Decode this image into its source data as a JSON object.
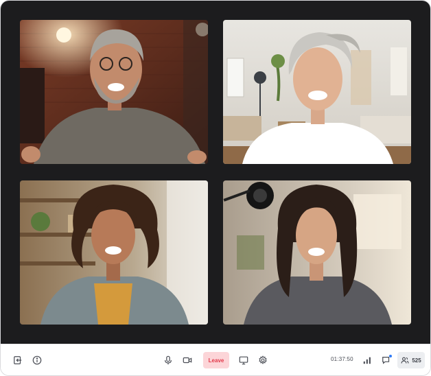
{
  "toolbar": {
    "leave_label": "Leave",
    "timer": "01:37:50",
    "participant_count": "525",
    "colors": {
      "leave_bg": "#fcd5d8",
      "leave_text": "#e23a4b",
      "notification": "#2f7bf6",
      "stage_bg": "#1c1c1e"
    },
    "icons": [
      "exit-icon",
      "info-icon",
      "microphone-icon",
      "camera-icon",
      "screen-share-icon",
      "gear-icon",
      "signal-icon",
      "chat-icon",
      "people-icon"
    ]
  },
  "tiles": [
    {
      "id": "tile-1",
      "scene": "brick wall, bearded man with glasses"
    },
    {
      "id": "tile-2",
      "scene": "bright living room, woman with gray hair"
    },
    {
      "id": "tile-3",
      "scene": "shelves, woman with curly hair"
    },
    {
      "id": "tile-4",
      "scene": "studio light, woman with long dark hair"
    }
  ]
}
